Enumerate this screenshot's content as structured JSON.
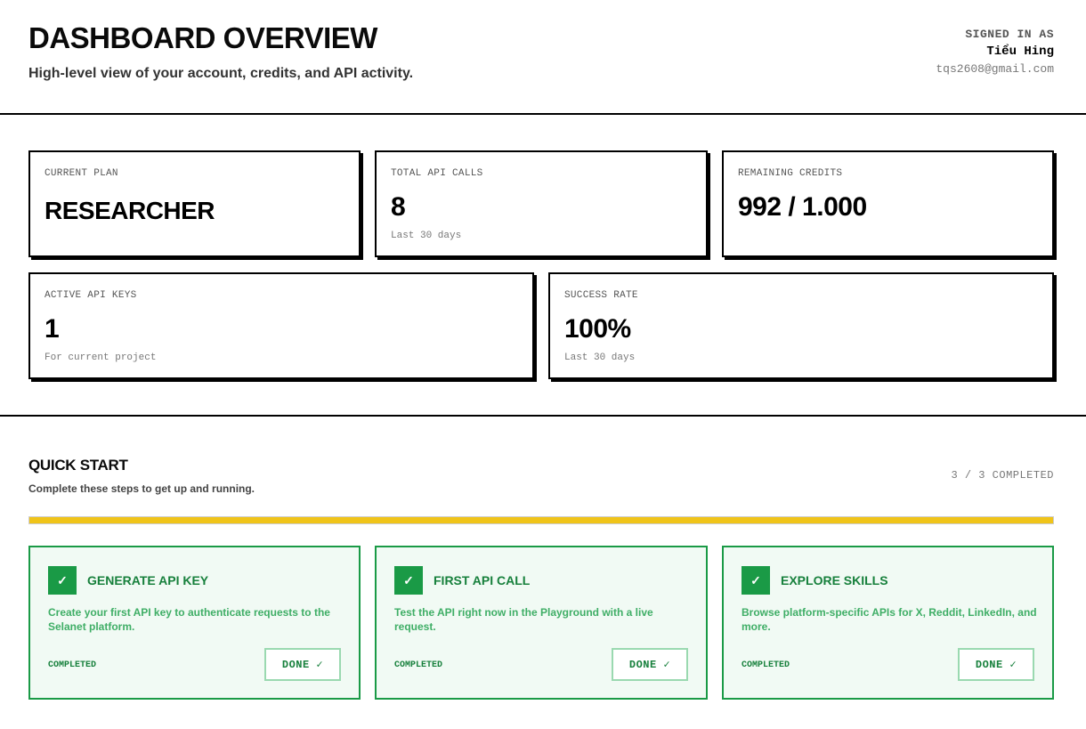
{
  "header": {
    "title": "DASHBOARD OVERVIEW",
    "subtitle": "High-level view of your account, credits, and API activity.",
    "user_label": "SIGNED IN AS",
    "user_name": "Tiểu Hing",
    "user_email": "tqs2608@gmail.com"
  },
  "stats": {
    "plan": {
      "label": "CURRENT PLAN",
      "value": "RESEARCHER"
    },
    "calls": {
      "label": "TOTAL API CALLS",
      "value": "8",
      "sub": "Last 30 days"
    },
    "credits": {
      "label": "REMAINING CREDITS",
      "value": "992 / 1.000"
    },
    "keys": {
      "label": "ACTIVE API KEYS",
      "value": "1",
      "sub": "For current project"
    },
    "success": {
      "label": "SUCCESS RATE",
      "value": "100%",
      "sub": "Last 30 days"
    }
  },
  "quick_start": {
    "title": "QUICK START",
    "subtitle": "Complete these steps to get up and running.",
    "count": "3 / 3 COMPLETED",
    "progress": 1.0,
    "steps": [
      {
        "title": "GENERATE API KEY",
        "description": "Create your first API key to authenticate requests to the Selanet platform.",
        "status": "COMPLETED",
        "button": "DONE ✓"
      },
      {
        "title": "FIRST API CALL",
        "description": "Test the API right now in the Playground with a live request.",
        "status": "COMPLETED",
        "button": "DONE ✓"
      },
      {
        "title": "EXPLORE SKILLS",
        "description": "Browse platform-specific APIs for X, Reddit, LinkedIn, and more.",
        "status": "COMPLETED",
        "button": "DONE ✓"
      }
    ]
  },
  "colors": {
    "accent_green": "#1a9a46",
    "progress_yellow": "#f0c419",
    "border": "#000000"
  },
  "icons": {
    "step_check": "check-icon"
  }
}
